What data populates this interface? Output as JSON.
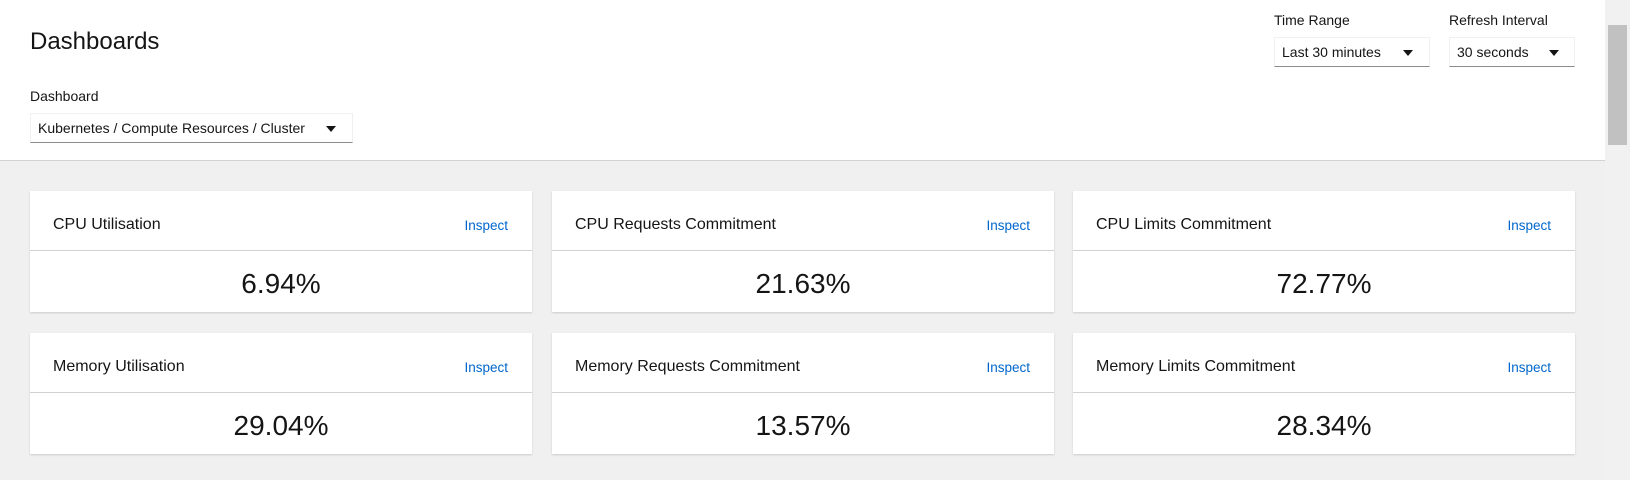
{
  "header": {
    "title": "Dashboards",
    "dashboard_label": "Dashboard",
    "dashboard_value": "Kubernetes / Compute Resources / Cluster",
    "time_range_label": "Time Range",
    "time_range_value": "Last 30 minutes",
    "refresh_label": "Refresh Interval",
    "refresh_value": "30 seconds"
  },
  "colors": {
    "link": "#0066cc",
    "background": "#f0f0f0",
    "card": "#ffffff"
  },
  "cards": [
    {
      "title": "CPU Utilisation",
      "action": "Inspect",
      "value": "6.94%"
    },
    {
      "title": "CPU Requests Commitment",
      "action": "Inspect",
      "value": "21.63%"
    },
    {
      "title": "CPU Limits Commitment",
      "action": "Inspect",
      "value": "72.77%"
    },
    {
      "title": "Memory Utilisation",
      "action": "Inspect",
      "value": "29.04%"
    },
    {
      "title": "Memory Requests Commitment",
      "action": "Inspect",
      "value": "13.57%"
    },
    {
      "title": "Memory Limits Commitment",
      "action": "Inspect",
      "value": "28.34%"
    }
  ]
}
